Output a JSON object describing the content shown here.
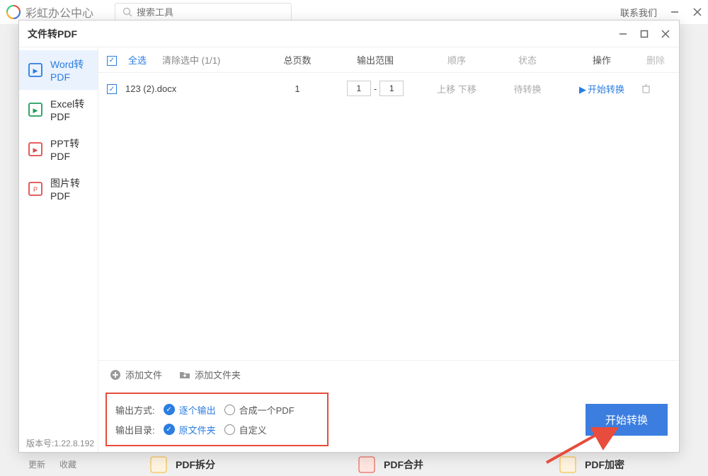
{
  "header": {
    "app_title": "彩虹办公中心",
    "search_placeholder": "搜索工具",
    "contact": "联系我们"
  },
  "modal": {
    "title": "文件转PDF",
    "sidebar": [
      {
        "label": "Word转PDF",
        "color": "#2a7de1"
      },
      {
        "label": "Excel转PDF",
        "color": "#1e9e5a"
      },
      {
        "label": "PPT转PDF",
        "color": "#e04b4b"
      },
      {
        "label": "图片转PDF",
        "color": "#e04b4b"
      }
    ],
    "columns": {
      "select_all": "全选",
      "clear": "清除选中 (1/1)",
      "pages": "总页数",
      "range": "输出范围",
      "order": "顺序",
      "status": "状态",
      "action": "操作",
      "delete": "删除"
    },
    "rows": [
      {
        "name": "123 (2).docx",
        "pages": "1",
        "range_from": "1",
        "range_to": "1",
        "up": "上移",
        "down": "下移",
        "status": "待转换",
        "action": "开始转换"
      }
    ],
    "add_file": "添加文件",
    "add_folder": "添加文件夹",
    "output": {
      "mode_label": "输出方式:",
      "mode_individual": "逐个输出",
      "mode_merge": "合成一个PDF",
      "dir_label": "输出目录:",
      "dir_original": "原文件夹",
      "dir_custom": "自定义"
    },
    "start_btn": "开始转换",
    "version": "版本号:1.22.8.192"
  },
  "bottom": {
    "refresh": "更新",
    "favorite": "收藏",
    "card1": "PDF拆分",
    "card2": "PDF合并",
    "card3": "PDF加密"
  }
}
